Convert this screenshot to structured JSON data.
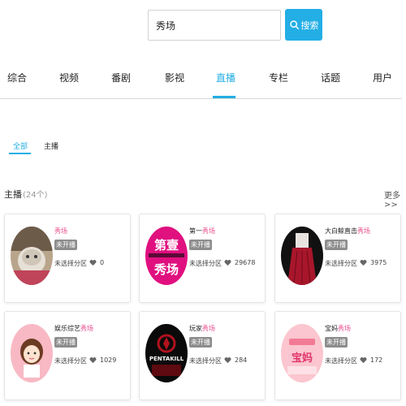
{
  "search": {
    "value": "秀场",
    "button_label": "搜索"
  },
  "tabs": [
    {
      "label": "综合"
    },
    {
      "label": "视频"
    },
    {
      "label": "番剧"
    },
    {
      "label": "影视"
    },
    {
      "label": "直播"
    },
    {
      "label": "专栏"
    },
    {
      "label": "话题"
    },
    {
      "label": "用户"
    }
  ],
  "active_tab": "直播",
  "subtabs": [
    {
      "label": "全部"
    },
    {
      "label": "主播"
    }
  ],
  "active_subtab": "全部",
  "section": {
    "title": "主播",
    "count": "(24个)",
    "more": "更多>>"
  },
  "cards": [
    {
      "name_prefix": "",
      "name_highlight": "秀场",
      "status": "未开播",
      "category": "未选择分区",
      "likes": "0",
      "avatar_icon": "cat-photo-avatar"
    },
    {
      "name_prefix": "第一",
      "name_highlight": "秀场",
      "status": "未开播",
      "category": "未选择分区",
      "likes": "29678",
      "avatar_icon": "diyi-xiuchang-logo-avatar"
    },
    {
      "name_prefix": "大白鲸直击",
      "name_highlight": "秀场",
      "status": "未开播",
      "category": "未选择分区",
      "likes": "3975",
      "avatar_icon": "red-dress-avatar"
    },
    {
      "name_prefix": "娱乐综艺",
      "name_highlight": "秀场",
      "status": "未开播",
      "category": "未选择分区",
      "likes": "1029",
      "avatar_icon": "cartoon-girl-avatar"
    },
    {
      "name_prefix": "玩家",
      "name_highlight": "秀场",
      "status": "未开播",
      "category": "未选择分区",
      "likes": "284",
      "avatar_icon": "pentakill-logo-avatar"
    },
    {
      "name_prefix": "宝妈",
      "name_highlight": "秀场",
      "status": "未开播",
      "category": "未选择分区",
      "likes": "172",
      "avatar_icon": "baoma-xiuchang-avatar"
    }
  ],
  "colors": {
    "accent": "#23aee5",
    "highlight": "#e84b8a",
    "badge": "#8d8d8d"
  }
}
